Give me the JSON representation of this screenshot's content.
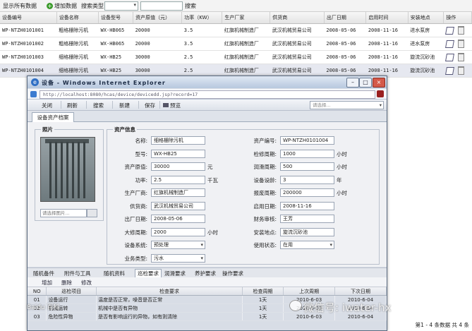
{
  "toolbar": {
    "show_all": "显示所有数据",
    "add": "增加数据",
    "search_type_label": "搜索类型",
    "search_button": "搜索"
  },
  "list": {
    "columns": [
      "设备编号",
      "设备名称",
      "设备型号",
      "资产原值（元）",
      "功率（KW）",
      "生产厂家",
      "供货商",
      "出厂日期",
      "启用时间",
      "安装地点",
      "操作"
    ],
    "rows": [
      [
        "WP-NTZH0101001",
        "粗格栅除污机",
        "WX-HB065",
        "20000",
        "3.5",
        "红旗机械制造厂",
        "武汉机械贸易公司",
        "2008-05-06",
        "2008-11-16",
        "进水泵房"
      ],
      [
        "WP-NTZH0101002",
        "粗格栅除污机",
        "WX-HB065",
        "20000",
        "3.5",
        "红旗机械制造厂",
        "武汉机械贸易公司",
        "2008-05-06",
        "2008-11-16",
        "进水泵房"
      ],
      [
        "WP-NTZH0101003",
        "细格栅除污机",
        "WX-HB25",
        "30000",
        "2.5",
        "红旗机械制造厂",
        "武汉机械贸易公司",
        "2008-05-06",
        "2008-11-16",
        "旋流沉砂池"
      ],
      [
        "WP-NTZH0101004",
        "细格栅除污机",
        "WX-HB25",
        "30000",
        "2.5",
        "红旗机械制造厂",
        "武汉机械贸易公司",
        "2008-05-06",
        "2008-11-16",
        "旋流沉砂池"
      ]
    ]
  },
  "window": {
    "title": "设备 - Windows Internet Explorer",
    "url": "http://localhost:8080/hcas/device/devicedd.jsp?record=17"
  },
  "app_toolbar": {
    "close": "关闭",
    "refresh": "刷新",
    "search": "搜索",
    "new": "新建",
    "save": "保存",
    "preview": "预览",
    "select_placeholder": "请选择..."
  },
  "tab": "设备资产档案",
  "photo": {
    "legend": "照片",
    "placeholder": "请选择图片..."
  },
  "asset": {
    "legend": "资产信息",
    "left": [
      {
        "label": "名称:",
        "value": "细格栅除污机",
        "unit": ""
      },
      {
        "label": "型号:",
        "value": "WX-HB25",
        "unit": ""
      },
      {
        "label": "资产原值:",
        "value": "30000",
        "unit": "元"
      },
      {
        "label": "功率:",
        "value": "2.5",
        "unit": "千瓦"
      },
      {
        "label": "生产厂商:",
        "value": "红旗机械制造厂",
        "unit": ""
      },
      {
        "label": "供货商:",
        "value": "武汉机械贸易公司",
        "unit": ""
      },
      {
        "label": "出厂日期:",
        "value": "2008-05-06",
        "unit": ""
      },
      {
        "label": "大修周期:",
        "value": "2000",
        "unit": "小时"
      },
      {
        "label": "设备系统:",
        "value": "预处理",
        "unit": ""
      },
      {
        "label": "业务类型:",
        "value": "污水",
        "unit": ""
      }
    ],
    "right": [
      {
        "label": "资产编号:",
        "value": "WP-NTZH0101004",
        "unit": ""
      },
      {
        "label": "检修周期:",
        "value": "1000",
        "unit": "小时"
      },
      {
        "label": "润滑周期:",
        "value": "500",
        "unit": "小时"
      },
      {
        "label": "设备设龄:",
        "value": "3",
        "unit": "年"
      },
      {
        "label": "报废周期:",
        "value": "200000",
        "unit": "小时"
      },
      {
        "label": "启用日期:",
        "value": "2008-11-16",
        "unit": ""
      },
      {
        "label": "财务审核:",
        "value": "王芳",
        "unit": ""
      },
      {
        "label": "安装地点:",
        "value": "旋流沉砂池",
        "unit": ""
      },
      {
        "label": "使用状态:",
        "value": "在用",
        "unit": ""
      }
    ]
  },
  "lower_tabs": [
    "随机备件",
    "附件与工具",
    "随机资料",
    "巡检要求",
    "润滑要求",
    "养护要求",
    "操作要求"
  ],
  "sub_toolbar": [
    "增加",
    "删除",
    "修改"
  ],
  "grid": {
    "columns": [
      "NO",
      "巡检项目",
      "检查要求",
      "检查周期",
      "上次周期",
      "下次日期"
    ],
    "rows": [
      [
        "01",
        "设备运行",
        "温度是否正常，噪音是否正常",
        "1天",
        "2010-6-03",
        "2010-6-04"
      ],
      [
        "02",
        "机械运转",
        "机械中是否有异物",
        "1天",
        "2010-6-03",
        "2010-6-04"
      ],
      [
        "03",
        "危险性异物",
        "是否有影响运行的异物，如有则清除",
        "1天",
        "2010-6-03",
        "2010-6-04"
      ]
    ]
  },
  "status": {
    "paging": "第1 - 4 条数据 共 4 条"
  },
  "watermark": "微信号: iwater-hx",
  "baidu": "Baidu 百科"
}
